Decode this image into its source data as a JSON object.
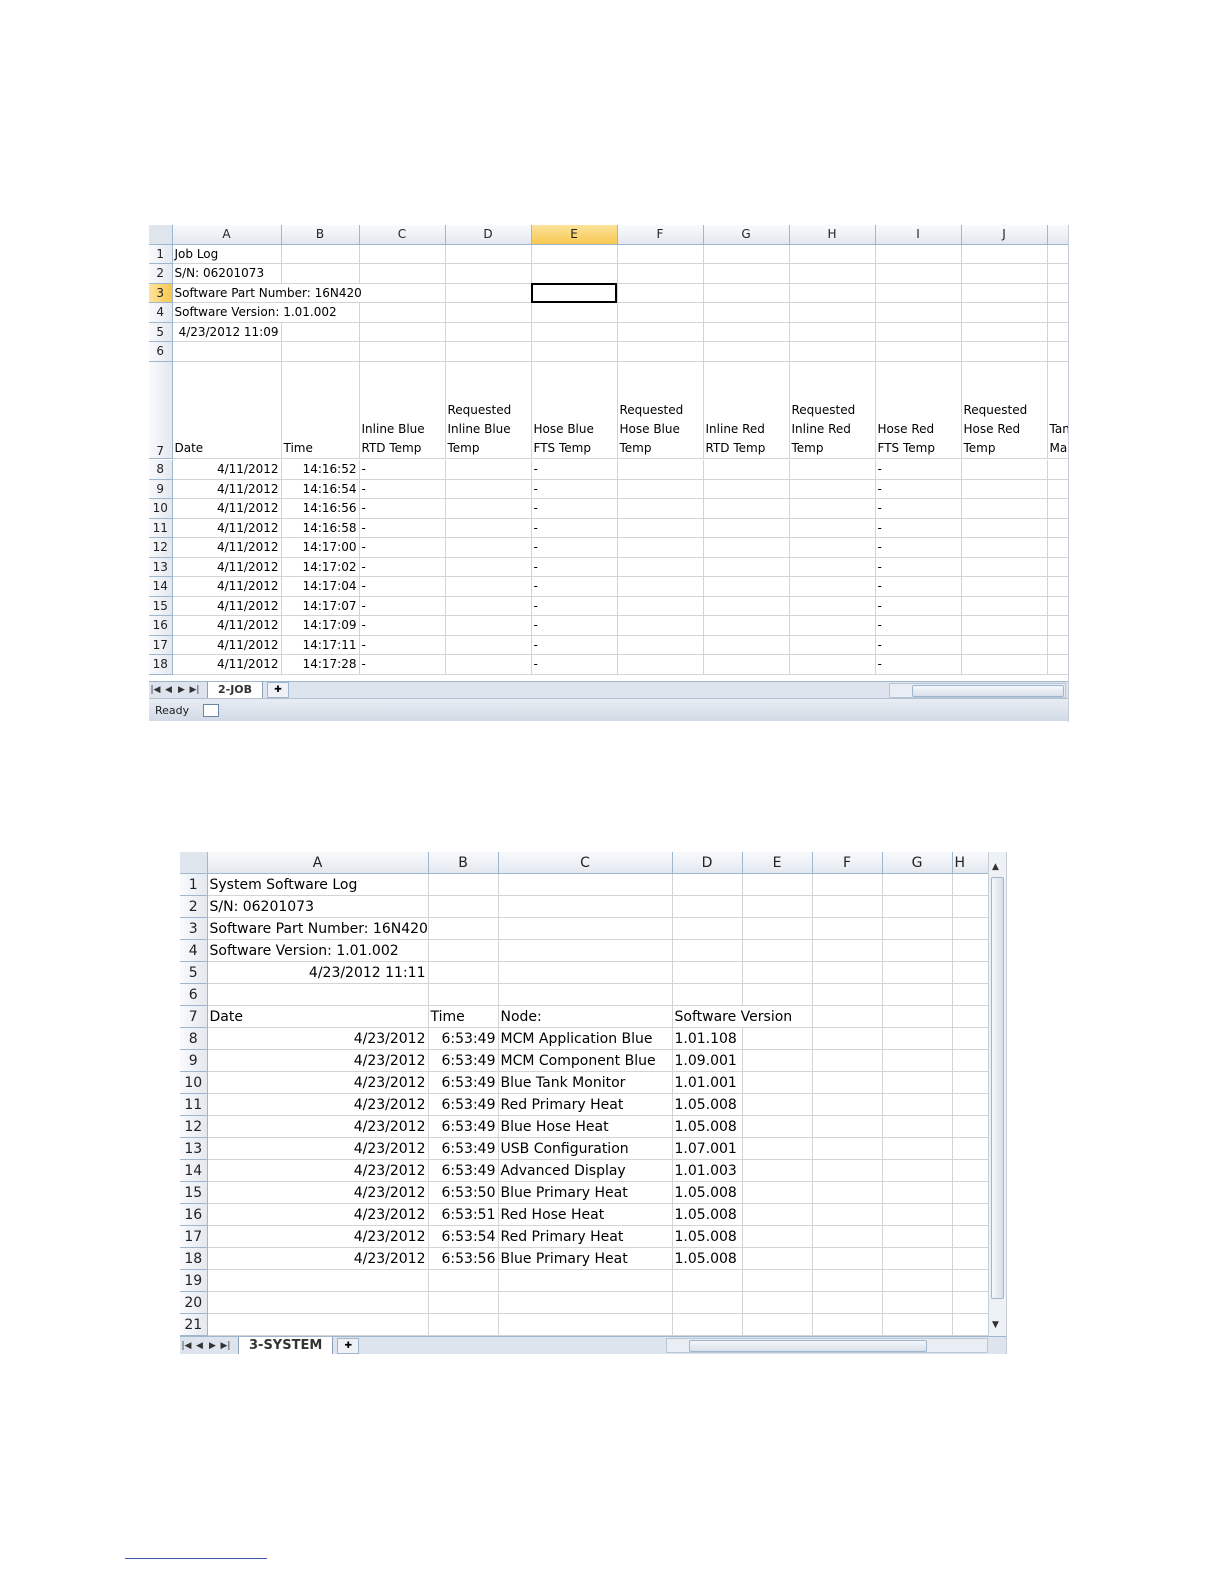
{
  "sheet1": {
    "columns": [
      "A",
      "B",
      "C",
      "D",
      "E",
      "F",
      "G",
      "H",
      "I",
      "J",
      ""
    ],
    "rows": [
      {
        "n": "1",
        "a": "Job Log"
      },
      {
        "n": "2",
        "a": "S/N: 06201073"
      },
      {
        "n": "3",
        "a": "Software Part Number: 16N420"
      },
      {
        "n": "4",
        "a": "Software Version: 1.01.002"
      },
      {
        "n": "5",
        "a": "4/23/2012 11:09"
      },
      {
        "n": "6",
        "a": ""
      }
    ],
    "headers": {
      "n": "7",
      "a": "Date",
      "b": "Time",
      "c": "Inline Blue RTD Temp",
      "d": "Requested Inline Blue Temp",
      "e": "Hose Blue FTS Temp",
      "f": "Requested Hose Blue Temp",
      "g": "Inline Red RTD Temp",
      "h": "Requested Inline Red Temp",
      "i": "Hose Red FTS Temp",
      "j": "Requested Hose Red Temp",
      "k": "Tank Ma Te"
    },
    "data": [
      {
        "n": "8",
        "date": "4/11/2012",
        "time": "14:16:52",
        "c": "-",
        "e": "-",
        "i": "-"
      },
      {
        "n": "9",
        "date": "4/11/2012",
        "time": "14:16:54",
        "c": "-",
        "e": "-",
        "i": "-"
      },
      {
        "n": "10",
        "date": "4/11/2012",
        "time": "14:16:56",
        "c": "-",
        "e": "-",
        "i": "-"
      },
      {
        "n": "11",
        "date": "4/11/2012",
        "time": "14:16:58",
        "c": "-",
        "e": "-",
        "i": "-"
      },
      {
        "n": "12",
        "date": "4/11/2012",
        "time": "14:17:00",
        "c": "-",
        "e": "-",
        "i": "-"
      },
      {
        "n": "13",
        "date": "4/11/2012",
        "time": "14:17:02",
        "c": "-",
        "e": "-",
        "i": "-"
      },
      {
        "n": "14",
        "date": "4/11/2012",
        "time": "14:17:04",
        "c": "-",
        "e": "-",
        "i": "-"
      },
      {
        "n": "15",
        "date": "4/11/2012",
        "time": "14:17:07",
        "c": "-",
        "e": "-",
        "i": "-"
      },
      {
        "n": "16",
        "date": "4/11/2012",
        "time": "14:17:09",
        "c": "-",
        "e": "-",
        "i": "-"
      },
      {
        "n": "17",
        "date": "4/11/2012",
        "time": "14:17:11",
        "c": "-",
        "e": "-",
        "i": "-"
      },
      {
        "n": "18",
        "date": "4/11/2012",
        "time": "14:17:28",
        "c": "-",
        "e": "-",
        "i": "-"
      }
    ],
    "tab_label": "2-JOB",
    "status": "Ready",
    "selected_cell": "E3"
  },
  "sheet2": {
    "columns": [
      "A",
      "B",
      "C",
      "D",
      "E",
      "F",
      "G",
      "H"
    ],
    "rows": [
      {
        "n": "1",
        "a": "System Software Log"
      },
      {
        "n": "2",
        "a": "S/N: 06201073"
      },
      {
        "n": "3",
        "a": "Software Part Number: 16N420"
      },
      {
        "n": "4",
        "a": "Software Version: 1.01.002"
      },
      {
        "n": "5",
        "a": "4/23/2012 11:11"
      },
      {
        "n": "6",
        "a": ""
      }
    ],
    "headers": {
      "n": "7",
      "a": "Date",
      "b": "Time",
      "c": "Node:",
      "d": "Software Version"
    },
    "data": [
      {
        "n": "8",
        "date": "4/23/2012",
        "time": "6:53:49",
        "node": "MCM Application Blue",
        "ver": "1.01.108"
      },
      {
        "n": "9",
        "date": "4/23/2012",
        "time": "6:53:49",
        "node": "MCM Component Blue",
        "ver": "1.09.001"
      },
      {
        "n": "10",
        "date": "4/23/2012",
        "time": "6:53:49",
        "node": "Blue Tank Monitor",
        "ver": "1.01.001"
      },
      {
        "n": "11",
        "date": "4/23/2012",
        "time": "6:53:49",
        "node": "Red Primary Heat",
        "ver": "1.05.008"
      },
      {
        "n": "12",
        "date": "4/23/2012",
        "time": "6:53:49",
        "node": "Blue Hose Heat",
        "ver": "1.05.008"
      },
      {
        "n": "13",
        "date": "4/23/2012",
        "time": "6:53:49",
        "node": "USB Configuration",
        "ver": "1.07.001"
      },
      {
        "n": "14",
        "date": "4/23/2012",
        "time": "6:53:49",
        "node": "Advanced Display",
        "ver": "1.01.003"
      },
      {
        "n": "15",
        "date": "4/23/2012",
        "time": "6:53:50",
        "node": "Blue Primary Heat",
        "ver": "1.05.008"
      },
      {
        "n": "16",
        "date": "4/23/2012",
        "time": "6:53:51",
        "node": "Red Hose Heat",
        "ver": "1.05.008"
      },
      {
        "n": "17",
        "date": "4/23/2012",
        "time": "6:53:54",
        "node": "Red Primary Heat",
        "ver": "1.05.008"
      },
      {
        "n": "18",
        "date": "4/23/2012",
        "time": "6:53:56",
        "node": "Blue Primary Heat",
        "ver": "1.05.008"
      }
    ],
    "empty_rows": [
      "19",
      "20",
      "21"
    ],
    "tab_label": "3-SYSTEM"
  }
}
